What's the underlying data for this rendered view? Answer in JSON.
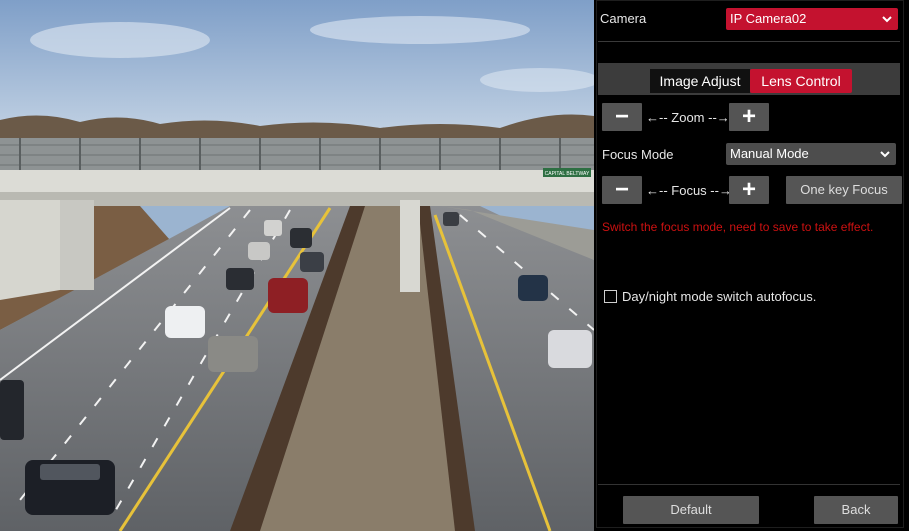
{
  "camera": {
    "label": "Camera",
    "value": "IP Camera02",
    "accent": "#c4122f"
  },
  "tabs": [
    {
      "label": "Image Adjust",
      "active": false
    },
    {
      "label": "Lens Control",
      "active": true
    }
  ],
  "zoom": {
    "minus": "−",
    "label": "Zoom",
    "plus": "+"
  },
  "focus_mode": {
    "label": "Focus Mode",
    "value": "Manual Mode"
  },
  "focus": {
    "minus": "−",
    "label": "Focus",
    "plus": "+",
    "one_key": "One key Focus"
  },
  "warning": "Switch the focus mode, need to save to take effect.",
  "autofocus": {
    "label": "Day/night mode switch autofocus.",
    "checked": false
  },
  "footer": {
    "default_label": "Default",
    "back_label": "Back"
  },
  "video": {
    "sign_text": "CAPITAL BELTWAY"
  }
}
